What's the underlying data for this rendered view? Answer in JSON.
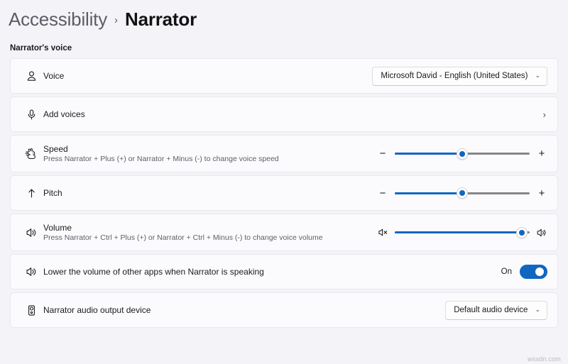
{
  "breadcrumb": {
    "parent": "Accessibility",
    "separator": "›",
    "current": "Narrator"
  },
  "section": {
    "label": "Narrator's voice"
  },
  "rows": {
    "voice": {
      "icon": "person-icon",
      "title": "Voice",
      "dropdown_value": "Microsoft David - English (United States)",
      "chevron": "⌄"
    },
    "add_voices": {
      "icon": "microphone-icon",
      "title": "Add voices",
      "chevron": "›"
    },
    "speed": {
      "icon": "speed-rabbit-icon",
      "title": "Speed",
      "subtitle": "Press Narrator + Plus (+) or Narrator + Minus (-) to change voice speed",
      "slider": {
        "left_glyph": "−",
        "right_glyph": "+",
        "value_percent": 50
      }
    },
    "pitch": {
      "icon": "up-arrow-icon",
      "title": "Pitch",
      "slider": {
        "left_glyph": "−",
        "right_glyph": "+",
        "value_percent": 50
      }
    },
    "volume": {
      "icon": "speaker-icon",
      "title": "Volume",
      "subtitle": "Press Narrator + Ctrl + Plus (+) or Narrator + Ctrl + Minus (-) to change voice volume",
      "slider": {
        "left_icon": "speaker-mute-icon",
        "right_icon": "speaker-icon",
        "value_percent": 94
      }
    },
    "lower_volume": {
      "icon": "speaker-icon",
      "title": "Lower the volume of other apps when Narrator is speaking",
      "toggle_state": "On"
    },
    "audio_device": {
      "icon": "audio-device-icon",
      "title": "Narrator audio output device",
      "dropdown_value": "Default audio device",
      "chevron": "⌄"
    }
  },
  "watermark": "wsxdn.com",
  "colors": {
    "accent": "#0f67c0",
    "page_background": "#f3f3f8",
    "card_background": "#fbfbfd",
    "track_gray": "#868686"
  }
}
